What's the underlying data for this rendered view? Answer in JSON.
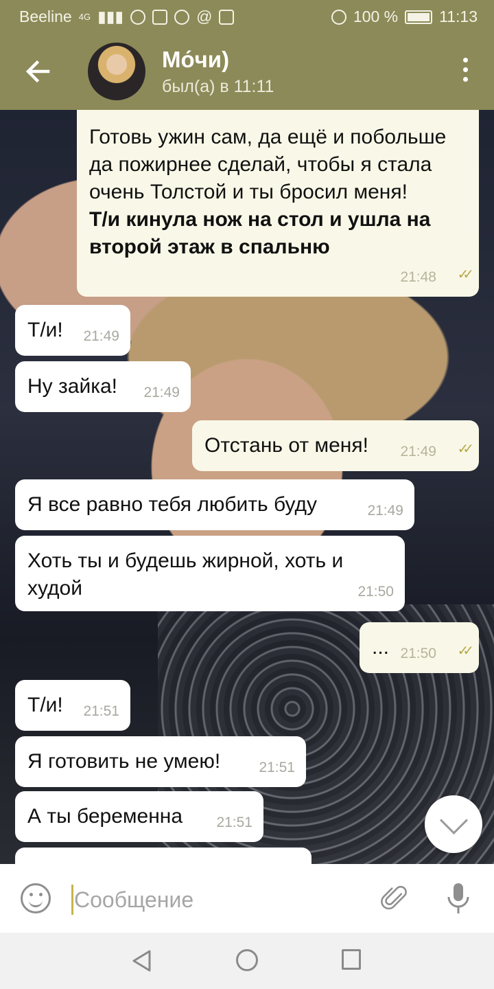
{
  "status_bar": {
    "carrier": "Beeline",
    "network": "4G",
    "battery": "100 %",
    "time": "11:13"
  },
  "header": {
    "back_icon": "arrow-left-icon",
    "contact_name": "Мо́чи)",
    "last_seen": "был(а) в 11:11",
    "menu_icon": "more-vertical-icon"
  },
  "messages": [
    {
      "dir": "out",
      "lines": [
        "Готовь ужин сам, да ещё и побольше да пожирнее сделай, чтобы я стала очень Толстой и ты бросил меня!"
      ],
      "bold": "Т/и кинула нож на стол и ушла на второй этаж в спальню",
      "time": "21:48",
      "read": true
    },
    {
      "dir": "in",
      "text": "Т/и!",
      "time": "21:49"
    },
    {
      "dir": "in",
      "text": "Ну зайка!",
      "time": "21:49"
    },
    {
      "dir": "out",
      "text": "Отстань от меня!",
      "time": "21:49",
      "read": true
    },
    {
      "dir": "in",
      "text": "Я все равно тебя любить буду",
      "time": "21:49"
    },
    {
      "dir": "in",
      "text": "Хоть ты и будешь жирной, хоть и худой",
      "time": "21:50"
    },
    {
      "dir": "out",
      "text": "...",
      "time": "21:50",
      "read": true
    },
    {
      "dir": "in",
      "text": "Т/и!",
      "time": "21:51"
    },
    {
      "dir": "in",
      "text": "Я готовить не умею!",
      "time": "21:51"
    },
    {
      "dir": "in",
      "text": "А ты беременна",
      "time": "21:51"
    }
  ],
  "input": {
    "placeholder": "Сообщение",
    "emoji_icon": "smile-icon",
    "attach_icon": "paperclip-icon",
    "mic_icon": "microphone-icon"
  },
  "colors": {
    "header": "#8c8a58",
    "incoming_bubble": "#ffffff",
    "outgoing_bubble": "#f9f8e8",
    "read_check": "#b6a94a"
  }
}
